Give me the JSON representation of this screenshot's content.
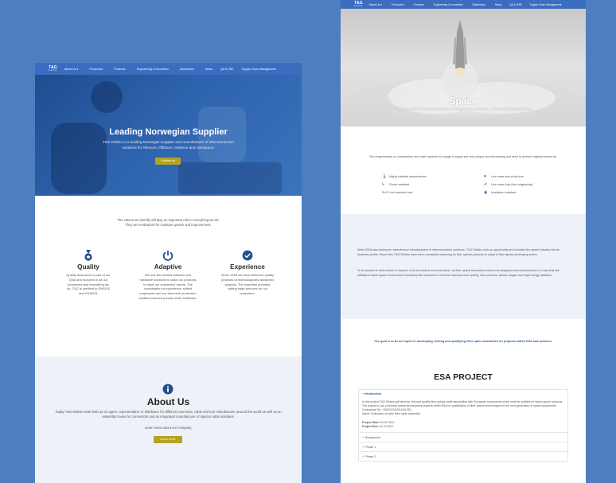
{
  "nav": {
    "logo": "T&G",
    "logo_sub": "ELEKTRO",
    "items": [
      "About Us",
      "Production",
      "Products",
      "Engineering & Innovation",
      "Distribution",
      "News",
      "QA & HSE",
      "Supply Chain Management"
    ],
    "dropdown_glyph": "▾"
  },
  "home": {
    "hero": {
      "title": "Leading Norwegian Supplier",
      "text": "T&G Elektro is a leading Norwegian supplier and manufacturer of interconnection solutions for Telecom, Offshore, Defence and Aerospace.",
      "button": "Contact us"
    },
    "values_text_1": "The values we identify will play an important role in everything we do.",
    "values_text_2": "They are motivators for constant growth and improvement.",
    "features": [
      {
        "icon": "medal-icon",
        "title": "Quality",
        "text": "Quality assurance is part of our DNA and included in all our processes and everything we do. T&G is certified to EN9100 and ISO9001"
      },
      {
        "icon": "power-icon",
        "title": "Adaptive",
        "text": "We use the newest software and hardware solutions to tailor our products to meet our customers' needs. The combination of experience, skilled employees and our fast track production facilities ensures precise order fulfillment."
      },
      {
        "icon": "check-circle-icon",
        "title": "Experience",
        "text": "Since 1955 we have delivered quality products to technologically advanced projects. The expertise provides cutting edge services for our customers."
      }
    ],
    "about": {
      "icon": "info-icon",
      "title": "About Us",
      "text": "Today T&G Elektro work both as an agent, representative or distributor for different connector, cable and tool manufacturer around the world as well as on assembly house for connectors and an integrated manufacturer of special cable solutions.",
      "learn_text": "Learn more about our company.",
      "button": "Learn more"
    }
  },
  "space": {
    "hero": {
      "title": "Space",
      "subtitle": "The space industry demands connection technologies that are flawless - T&G Elektro can provide them."
    },
    "intro": "The requirements on components and cable systems for usage in space are very unique and demanding and need to achieve highest scores for:",
    "requirements": [
      {
        "icon": "thermometer-icon",
        "glyph": "🌡",
        "text": "Highly variable temperatures"
      },
      {
        "icon": "lightning-icon",
        "glyph": "ϟ",
        "text": "Shock resistant"
      },
      {
        "icon": "arrows-icon",
        "glyph": "⟷",
        "text": "Low insertion loss"
      },
      {
        "icon": "heart-icon",
        "glyph": "♥",
        "text": "Low mass and small size"
      },
      {
        "icon": "check-icon",
        "glyph": "✔",
        "text": "Low mass loss (low outgassing)"
      },
      {
        "icon": "eye-icon",
        "glyph": "◉",
        "text": "Irradiation resistant"
      }
    ],
    "para1": "When ESA was looking for experienced manufacturers of interconnection solutions, T&G Elektro took an opportunity and included the space industry into its business profile. Since then T&G Elektro have been constantly improving its fiber optical products to adapt to this rapidly developing sector.",
    "para2": "To be present in that market, it requires a lot of research and innovation, as fiber optical harnesses need to be designed and manufactured in a way that will withstand harsh space environment conditions like exposure to extreme heat and cold cycling, ultra-vacuum, atomic oxygen and high energy radiation.",
    "goal": "Our goal is to be an expert in developing, testing and qualifying fiber optic assemblies for projects within ESA and avionics.",
    "esa_title": "ESA PROJECT",
    "accordion": {
      "open_label": "Introduction",
      "open_text": "In this project T&G Elektro will develop, test and qualify fiber optical cable assemblies with European components which shall be suitable for future space missions. The project is one of several partial development projects within ESA for qualification of fiber optical technologies for the next generation of space equipments.",
      "contract": "Contractual No.: 4000102493/11/NL/RA",
      "name": "Name: Evaluation of optic fibre cable assembly",
      "start_label": "Project Start:",
      "start": "03.01.2011",
      "end_label": "Project End:",
      "end": "01.11.2012",
      "collapsed": [
        "Background",
        "Phase 1",
        "Phase 2"
      ]
    }
  },
  "colors": {
    "background": "#4e7ec0",
    "nav": "#3a6cc0",
    "accent": "#b5a31f",
    "icon": "#244e8f"
  }
}
